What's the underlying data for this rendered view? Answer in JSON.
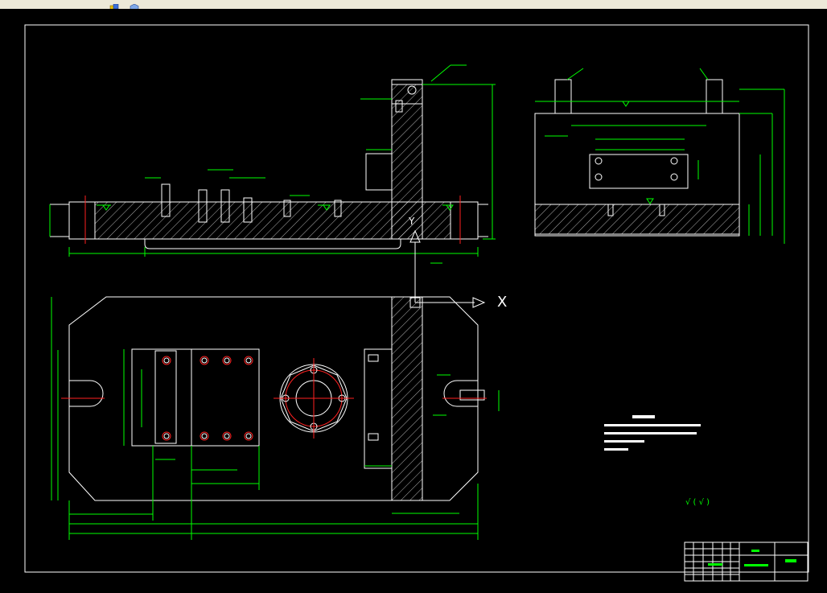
{
  "toolbar": {
    "buttons": [
      {
        "icon": "layer-state-icon"
      },
      {
        "icon": "hexagon-icon"
      }
    ]
  },
  "drawing": {
    "background": "#000000",
    "line_color": "#ffffff",
    "dimension_color": "#00ff00",
    "center_color": "#ff2020"
  },
  "ucs": {
    "x_label": "X",
    "y_label": "Y"
  },
  "notes": {
    "symbol_text": "√ ( √ )"
  }
}
